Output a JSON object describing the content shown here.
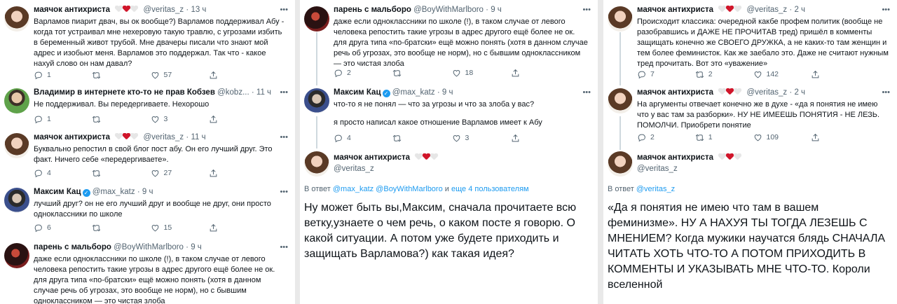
{
  "icons": {
    "reply": "reply-icon",
    "retweet": "retweet-icon",
    "like": "like-icon",
    "share": "share-icon",
    "more": "more-icon",
    "verified": "verified-badge-icon",
    "heart_white": "white-heart-icon",
    "heart_red": "red-heart-icon"
  },
  "colors": {
    "accent": "#1d9bf0",
    "heart_red": "#d0152a",
    "secondary_text": "#536471"
  },
  "col1": {
    "t1": {
      "name": "маячок антихриста",
      "handle": "@veritas_z",
      "time": "13 ч",
      "text": "Варламов пиарит двач, вы ок вообще?) Варламов поддерживал Абу - когда тот устраивал мне нехеровую такую травлю, с угрозами избить в беременный живот трубой. Мне двачеры писали что знают мой адрес и изобьют меня. Варламов это поддержал. Так что - какое нахуй слово он нам давал?",
      "replies": "1",
      "retweets": "",
      "likes": "57"
    },
    "t2": {
      "name": "Владимир в интернете кто-то не прав Кобзев",
      "handle": "@kobz...",
      "time": "11 ч",
      "text": "Не поддерживал. Вы передергиваете. Нехорошо",
      "replies": "1",
      "retweets": "",
      "likes": "3"
    },
    "t3": {
      "name": "маячок антихриста",
      "handle": "@veritas_z",
      "time": "11 ч",
      "text": "Буквально репостил в свой блог пост абу. Он его лучший друг. Это факт. Ничего себе «передергиваете».",
      "replies": "4",
      "retweets": "",
      "likes": "27"
    },
    "t4": {
      "name": "Максим Кац",
      "handle": "@max_katz",
      "time": "9 ч",
      "text": "лучший друг? он не его лучший друг и вообще не друг, они просто одноклассники по школе",
      "replies": "6",
      "retweets": "",
      "likes": "15"
    },
    "t5": {
      "name": "парень с мальборо",
      "handle": "@BoyWithMarlboro",
      "time": "9 ч",
      "text": "даже если одноклассники по школе (!), в таком случае от левого человека репостить такие угрозы в адрес другого ещё более не ок. для друга типа «по-братски» ещё можно понять (хотя в данном случае речь об угрозах, это вообще не норм), но с бывшим одноклассником — это чистая злоба"
    }
  },
  "col2": {
    "t1": {
      "name": "парень с мальборо",
      "handle": "@BoyWithMarlboro",
      "time": "9 ч",
      "text": "даже если одноклассники по школе (!), в таком случае от левого человека репостить такие угрозы в адрес другого ещё более не ок. для друга типа «по-братски» ещё можно понять (хотя в данном случае речь об угрозах, это вообще не норм), но с бывшим одноклассником — это чистая злоба",
      "replies": "2",
      "retweets": "",
      "likes": "18"
    },
    "t2": {
      "name": "Максим Кац",
      "handle": "@max_katz",
      "time": "9 ч",
      "text": "что-то я не понял — что за угрозы и что за злоба у вас?",
      "text2": "я просто написал какое отношение Варламов имеет к Абу",
      "replies": "4",
      "retweets": "",
      "likes": "3"
    },
    "t3": {
      "name": "маячок антихриста",
      "handle": "@veritas_z",
      "reply_prefix": "В ответ",
      "reply_to": "@max_katz @BoyWithMarlboro",
      "reply_and": "и",
      "reply_more": "еще 4 пользователям",
      "text": "Ну может быть вы,Максим, сначала прочитаете всю ветку,узнаете о чем речь, о каком посте я говорю. О какой ситуации. А потом уже будете приходить и защищать Варламова?) как такая идея?"
    }
  },
  "col3": {
    "t1": {
      "name": "маячок антихриста",
      "handle": "@veritas_z",
      "time": "2 ч",
      "text": "Происходит классика: очередной какбе профем политик (вообще не разобравшись и ДАЖЕ НЕ ПРОЧИТАВ тред) пришёл в комменты защищать конечно же СВОЕГО ДРУЖКА, а не каких-то там женщин и тем более феминисток. Как же заебало это. Даже не считают нужным тред прочитать. Вот это «уважение»",
      "replies": "7",
      "retweets": "2",
      "likes": "142"
    },
    "t2": {
      "name": "маячок антихриста",
      "handle": "@veritas_z",
      "time": "2 ч",
      "text": "На аргументы отвечает конечно же в духе - «да я понятия не имею что у вас там за разборки». НУ НЕ ИМЕЕШЬ ПОНЯТИЯ - НЕ ЛЕЗЬ. ПОМОЛЧИ. Приобрети понятие",
      "replies": "2",
      "retweets": "1",
      "likes": "109"
    },
    "t3": {
      "name": "маячок антихриста",
      "handle": "@veritas_z",
      "reply_prefix": "В ответ",
      "reply_to": "@veritas_z",
      "text": "«Да я понятия не имею что там в вашем феминизме». НУ А НАХУЯ ТЫ ТОГДА ЛЕЗЕШЬ С МНЕНИЕМ? Когда мужики научатся блядь СНАЧАЛА ЧИТАТЬ ХОТЬ ЧТО-ТО А ПОТОМ ПРИХОДИТЬ В КОММЕНТЫ И УКАЗЫВАТЬ МНЕ ЧТО-ТО. Короли вселенной"
    }
  }
}
